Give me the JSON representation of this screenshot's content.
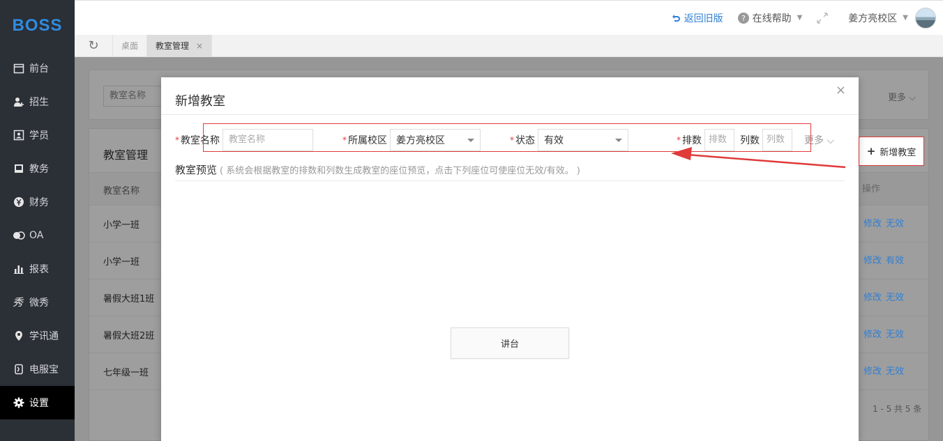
{
  "logo": "BOSS",
  "sidebar": {
    "items": [
      {
        "label": "前台",
        "icon": "calendar-icon"
      },
      {
        "label": "招生",
        "icon": "add-user-icon"
      },
      {
        "label": "学员",
        "icon": "id-card-icon"
      },
      {
        "label": "教务",
        "icon": "book-icon"
      },
      {
        "label": "财务",
        "icon": "yen-icon"
      },
      {
        "label": "OA",
        "icon": "toggle-icon"
      },
      {
        "label": "报表",
        "icon": "bar-chart-icon"
      },
      {
        "label": "微秀",
        "icon": "xiu-icon"
      },
      {
        "label": "学讯通",
        "icon": "location-icon"
      },
      {
        "label": "电服宝",
        "icon": "phone-icon"
      },
      {
        "label": "设置",
        "icon": "gear-icon"
      }
    ],
    "active": "设置"
  },
  "topbar": {
    "back_old": "返回旧版",
    "help": "在线帮助",
    "campus": "姜方亮校区"
  },
  "tabs": [
    {
      "label": "桌面"
    },
    {
      "label": "教室管理",
      "close": "×"
    }
  ],
  "background": {
    "search_placeholder": "教室名称",
    "more": "更多",
    "list_title": "教室管理",
    "col_name": "教室名称",
    "col_op": "操作",
    "add_button": "新增教室",
    "rows": [
      {
        "name": "小学一班",
        "edit": "修改",
        "toggle": "无效"
      },
      {
        "name": "小学一班",
        "edit": "修改",
        "toggle": "有效"
      },
      {
        "name": "暑假大班1班",
        "edit": "修改",
        "toggle": "无效"
      },
      {
        "name": "暑假大班2班",
        "edit": "修改",
        "toggle": "无效"
      },
      {
        "name": "七年级一班",
        "edit": "修改",
        "toggle": "无效"
      }
    ],
    "pager": "1 - 5   共 5 条"
  },
  "modal": {
    "title": "新增教室",
    "close": "×",
    "required_mark": "*",
    "fields": {
      "name_label": "教室名称",
      "name_placeholder": "教室名称",
      "campus_label": "所属校区",
      "campus_value": "姜方亮校区",
      "status_label": "状态",
      "status_value": "有效",
      "rows_label": "排数",
      "rows_placeholder": "排数",
      "cols_label": "列数",
      "cols_placeholder": "列数",
      "more": "更多"
    },
    "preview_title": "教室预览",
    "preview_hint": "( 系统会根据教室的排数和列数生成教室的座位预览，点击下列座位可使座位无效/有效。 )",
    "podium": "讲台"
  },
  "colors": {
    "sidebar_bg": "#2b2f36",
    "accent_blue": "#2f7fd5",
    "highlight_red": "#e03a3a"
  }
}
